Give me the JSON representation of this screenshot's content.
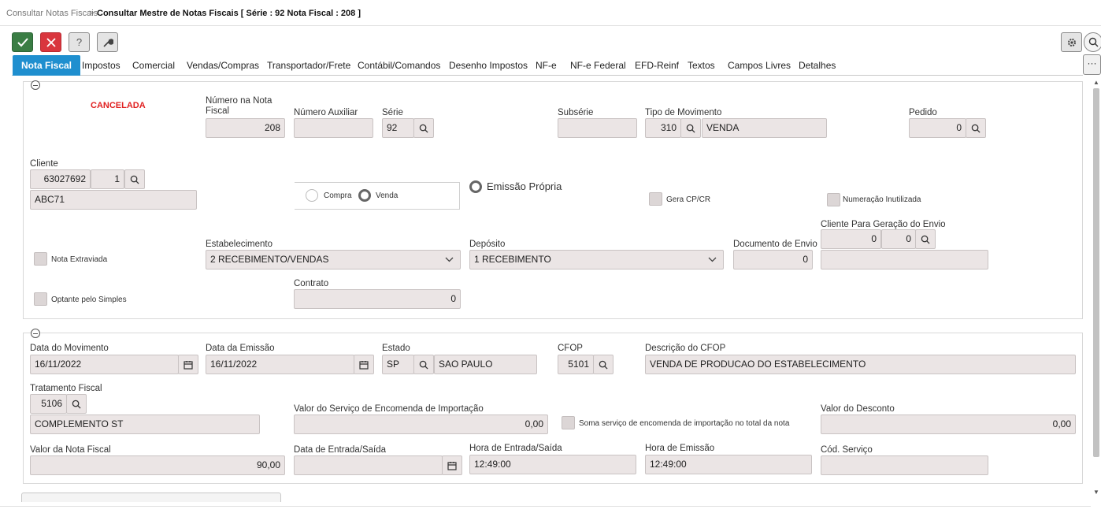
{
  "breadcrumb": {
    "parent": "Consultar Notas Fiscais",
    "separator": ">",
    "current": "Consultar Mestre de Notas Fiscais [ Série : 92 Nota Fiscal : 208 ]"
  },
  "toolbar": {
    "confirm_icon": "check-icon",
    "cancel_icon": "close-icon",
    "help_label": "?",
    "tools_icon": "wrench-icon",
    "colors": {
      "confirm": "#3a7d44",
      "cancel": "#d9363e"
    }
  },
  "tabs": [
    {
      "label": "Nota Fiscal",
      "active": true
    },
    {
      "label": "Impostos"
    },
    {
      "label": "Comercial"
    },
    {
      "label": "Vendas/Compras"
    },
    {
      "label": "Transportador/Frete"
    },
    {
      "label": "Contábil/Comandos"
    },
    {
      "label": "Desenho Impostos"
    },
    {
      "label": "NF-e"
    },
    {
      "label": "NF-e Federal"
    },
    {
      "label": "EFD-Reinf"
    },
    {
      "label": "Textos"
    },
    {
      "label": "Campos Livres"
    },
    {
      "label": "Detalhes"
    }
  ],
  "more_label": "···",
  "section1": {
    "status": "CANCELADA",
    "status_color": "#e02020",
    "numero_nf": {
      "label": "Número na Nota Fiscal",
      "value": "208"
    },
    "numero_aux": {
      "label": "Número Auxiliar",
      "value": ""
    },
    "serie": {
      "label": "Série",
      "value": "92"
    },
    "subserie": {
      "label": "Subsérie",
      "value": ""
    },
    "tipo_movimento": {
      "label": "Tipo de Movimento",
      "code": "310",
      "desc": "VENDA"
    },
    "pedido": {
      "label": "Pedido",
      "value": "0"
    },
    "cliente": {
      "label": "Cliente",
      "code": "63027692",
      "seq": "1",
      "name": "ABC71"
    },
    "radio_compra": "Compra",
    "radio_venda": "Venda",
    "emissao_propria": "Emissão Própria",
    "gera_cp": "Gera CP/CR",
    "numeracao_inutilizada": "Numeração Inutilizada",
    "nota_extraviada": "Nota Extraviada",
    "optante_simples": "Optante pelo Simples",
    "estabelecimento": {
      "label": "Estabelecimento",
      "value": "2 RECEBIMENTO/VENDAS"
    },
    "deposito": {
      "label": "Depósito",
      "value": "1 RECEBIMENTO"
    },
    "documento_envio": {
      "label": "Documento de Envio",
      "value": "0"
    },
    "cliente_envio": {
      "label": "Cliente Para Geração do Envio",
      "code": "0",
      "seq": "0",
      "name": ""
    },
    "contrato": {
      "label": "Contrato",
      "value": "0"
    }
  },
  "section2": {
    "data_movimento": {
      "label": "Data do Movimento",
      "value": "16/11/2022"
    },
    "data_emissao": {
      "label": "Data da Emissão",
      "value": "16/11/2022"
    },
    "estado": {
      "label": "Estado",
      "code": "SP",
      "name": "SAO PAULO"
    },
    "cfop": {
      "label": "CFOP",
      "value": "5101"
    },
    "descricao_cfop": {
      "label": "Descrição do CFOP",
      "value": "VENDA DE PRODUCAO DO ESTABELECIMENTO"
    },
    "tratamento_fiscal": {
      "label": "Tratamento Fiscal",
      "code": "5106",
      "desc": "COMPLEMENTO ST"
    },
    "valor_servico_importacao": {
      "label": "Valor do Serviço de Encomenda de Importação",
      "value": "0,00"
    },
    "soma_servico": "Soma serviço de encomenda de importação no total da nota",
    "valor_desconto": {
      "label": "Valor do Desconto",
      "value": "0,00"
    },
    "valor_nota": {
      "label": "Valor da Nota Fiscal",
      "value": "90,00"
    },
    "data_entrada_saida": {
      "label": "Data de Entrada/Saída",
      "value": ""
    },
    "hora_entrada_saida": {
      "label": "Hora de Entrada/Saída",
      "value": "12:49:00"
    },
    "hora_emissao": {
      "label": "Hora de Emissão",
      "value": "12:49:00"
    },
    "cod_servico": {
      "label": "Cód. Serviço",
      "value": ""
    }
  }
}
